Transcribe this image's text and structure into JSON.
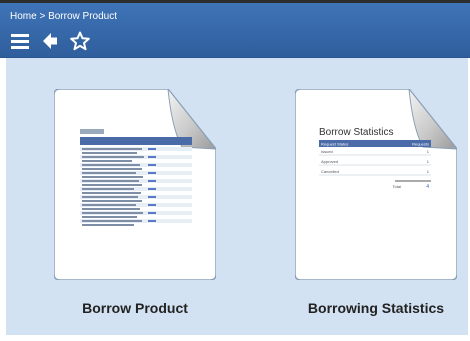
{
  "breadcrumb": "Home > Borrow Product",
  "toolbar": {
    "menu_icon": "hamburger-menu-icon",
    "back_icon": "back-arrow-icon",
    "favorite_icon": "star-icon"
  },
  "colors": {
    "header": "#3569ab",
    "main_bg": "#d3e2f2",
    "card_border": "#8aa0b6"
  },
  "cards": [
    {
      "label": "Borrow Product",
      "thumb_title": "Borrow Product"
    },
    {
      "label": "Borrowing Statistics",
      "thumb_title": "Borrow Statistics",
      "thumb_header": [
        "Request Status",
        "Requests"
      ],
      "thumb_rows": [
        [
          "Issued",
          "1"
        ],
        [
          "Approved",
          "1"
        ],
        [
          "Cancelled",
          "1"
        ]
      ],
      "thumb_total_label": "Total",
      "thumb_total_value": "4"
    }
  ]
}
